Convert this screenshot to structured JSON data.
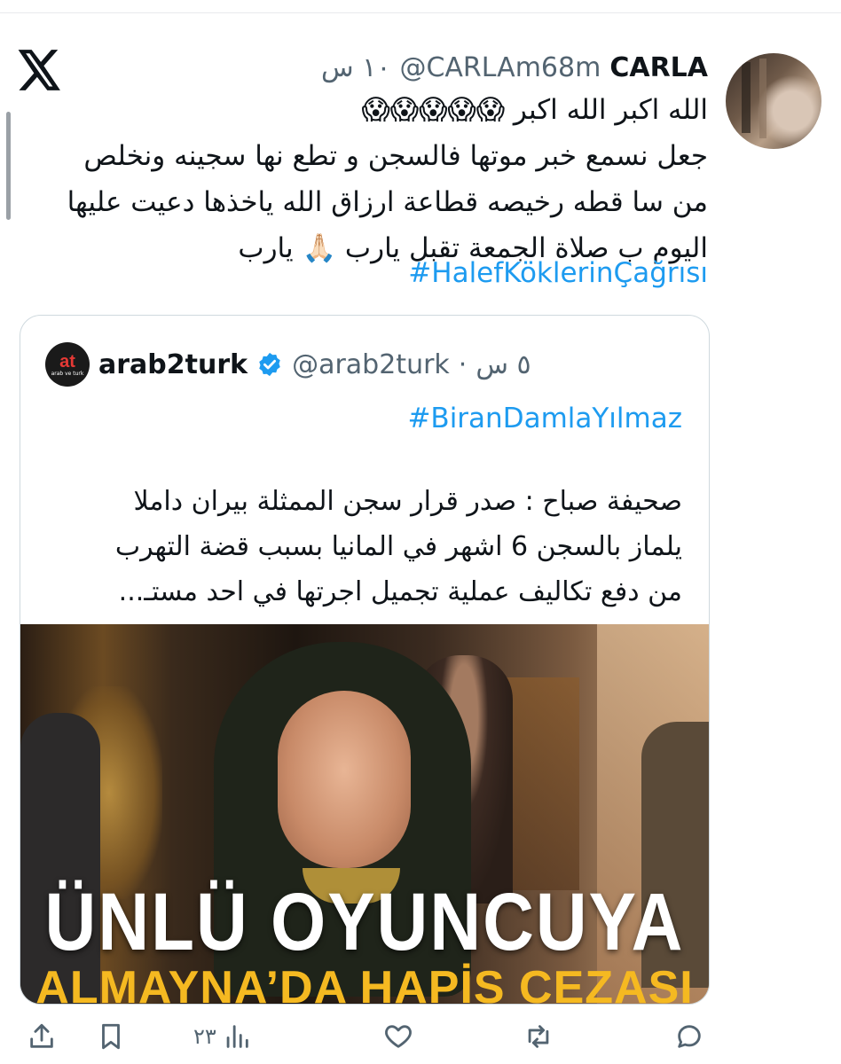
{
  "tweet": {
    "author_name": "CARLA",
    "author_handle": "@CARLAm68m",
    "time": "١٠ س",
    "lines": [
      "الله اكبر الله اكبر 😱😱😱😱😱",
      "جعل نسمع خبر موتها فالسجن و تطع نها سجينه ونخلص",
      "من سا قطه رخيصه قطاعة ارزاق الله ياخذها دعيت عليها",
      "اليوم ب صلاة الجمعة تقبل يارب 🙏🏻 يارب"
    ],
    "hashtag": "#HalefKöklerinÇağrısı"
  },
  "quote": {
    "author_name": "arab2turk",
    "author_handle": "@arab2turk",
    "time": "٥ س",
    "logo_text": "at",
    "logo_subtext": "arab ve turk",
    "hashtag": "#BiranDamlaYılmaz",
    "lines": [
      "صحيفة صباح : صدر قرار سجن الممثلة بيران داملا",
      "يلماز بالسجن 6 اشهر في المانيا بسبب قضة التهرب",
      "من دفع تكاليف عملية تجميل اجرتها في احد مستـ..."
    ],
    "image": {
      "headline": "ÜNLÜ OYUNCUYA",
      "subline": "ALMAYNA’DA HAPİS CEZASI"
    }
  },
  "actions": {
    "views_count": "٢٣"
  },
  "colors": {
    "link": "#1d9bf0",
    "secondary_text": "#536471",
    "border": "#cfd9de",
    "verified": "#1d9bf0",
    "headline_yellow": "#f5b921"
  }
}
